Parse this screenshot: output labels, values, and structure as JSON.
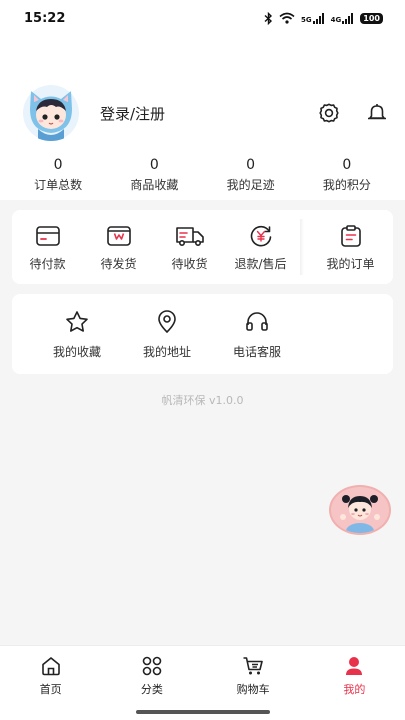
{
  "status_bar": {
    "time": "15:22",
    "network": "5G",
    "network2": "4G",
    "battery": "100"
  },
  "profile": {
    "login_label": "登录/注册"
  },
  "stats": [
    {
      "value": "0",
      "label": "订单总数"
    },
    {
      "value": "0",
      "label": "商品收藏"
    },
    {
      "value": "0",
      "label": "我的足迹"
    },
    {
      "value": "0",
      "label": "我的积分"
    }
  ],
  "orders": {
    "items": [
      {
        "label": "待付款",
        "icon": "wallet-card-icon"
      },
      {
        "label": "待发货",
        "icon": "package-box-icon"
      },
      {
        "label": "待收货",
        "icon": "delivery-truck-icon"
      },
      {
        "label": "退款/售后",
        "icon": "refund-yen-icon"
      }
    ],
    "all": {
      "label": "我的订单",
      "icon": "order-clipboard-icon"
    }
  },
  "services": [
    {
      "label": "我的收藏",
      "icon": "star-icon"
    },
    {
      "label": "我的地址",
      "icon": "location-pin-icon"
    },
    {
      "label": "电话客服",
      "icon": "headset-icon"
    }
  ],
  "version": "帆清环保 v1.0.0",
  "tabbar": [
    {
      "label": "首页",
      "icon": "home-icon",
      "active": false
    },
    {
      "label": "分类",
      "icon": "category-grid-icon",
      "active": false
    },
    {
      "label": "购物车",
      "icon": "cart-icon",
      "active": false
    },
    {
      "label": "我的",
      "icon": "person-icon",
      "active": true
    }
  ],
  "colors": {
    "accent": "#e8324b",
    "background": "#f5f5f5",
    "card": "#ffffff"
  }
}
